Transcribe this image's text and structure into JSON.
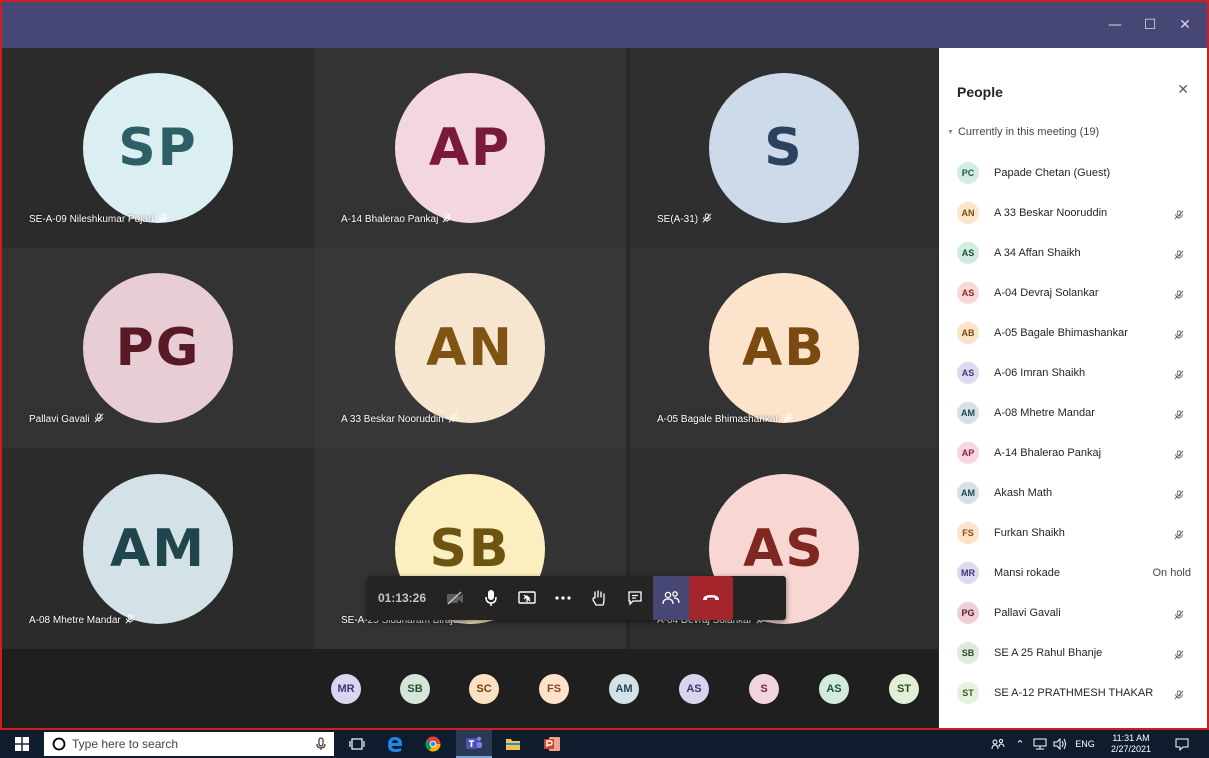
{
  "window": {
    "title_bar_color": "#464775",
    "controls": [
      "minimize-icon",
      "maximize-icon",
      "close-icon"
    ]
  },
  "grid": [
    {
      "initials": "SP",
      "name": "SE-A-09 Nileshkumar Pujari",
      "bg": "#dbeef1",
      "fg": "#2e5e66",
      "muted": true
    },
    {
      "initials": "AP",
      "name": "A-14 Bhalerao Pankaj",
      "bg": "#f4d6df",
      "fg": "#7a1a3a",
      "muted": true
    },
    {
      "initials": "S",
      "name": "SE(A-31)",
      "bg": "#ccdaea",
      "fg": "#2c4360",
      "muted": true
    },
    {
      "initials": "PG",
      "name": "Pallavi Gavali",
      "bg": "#e9cdd4",
      "fg": "#581b26",
      "muted": true
    },
    {
      "initials": "AN",
      "name": "A 33 Beskar Nooruddin",
      "bg": "#f6e6cf",
      "fg": "#7f5312",
      "muted": true
    },
    {
      "initials": "AB",
      "name": "A-05 Bagale Bhimashankar",
      "bg": "#fbe3cc",
      "fg": "#7b4a10",
      "muted": true
    },
    {
      "initials": "AM",
      "name": "A-08 Mhetre Mandar",
      "bg": "#d3e2e6",
      "fg": "#20454c",
      "muted": true
    },
    {
      "initials": "SB",
      "name": "SE-A-25 Siddharam Birajdar",
      "bg": "#fbefbf",
      "fg": "#6d5411",
      "muted": true
    },
    {
      "initials": "AS",
      "name": "A-04 Devraj Solankar",
      "bg": "#f8d7d3",
      "fg": "#7d2821",
      "muted": true
    }
  ],
  "call": {
    "timer": "01:13:26",
    "buttons": [
      "camera-off-icon",
      "microphone-icon",
      "share-screen-icon",
      "more-icon",
      "raise-hand-icon",
      "chat-icon",
      "participants-icon"
    ]
  },
  "overflow": [
    {
      "initials": "MR",
      "bg": "#d9d6f0",
      "fg": "#3d3675"
    },
    {
      "initials": "SB",
      "bg": "#d5e6d8",
      "fg": "#2b4d31"
    },
    {
      "initials": "SC",
      "bg": "#fbe0c4",
      "fg": "#6b4110"
    },
    {
      "initials": "FS",
      "bg": "#fde2c9",
      "fg": "#8a4a1a"
    },
    {
      "initials": "AM",
      "bg": "#d3e2e6",
      "fg": "#20454c"
    },
    {
      "initials": "AS",
      "bg": "#d7d5ee",
      "fg": "#3b3670"
    },
    {
      "initials": "S",
      "bg": "#f2d4dc",
      "fg": "#84213e"
    },
    {
      "initials": "AS",
      "bg": "#d3ebdd",
      "fg": "#1f5233"
    },
    {
      "initials": "ST",
      "bg": "#e1efd7",
      "fg": "#2d4f1b"
    }
  ],
  "people": {
    "title": "People",
    "section": "Currently in this meeting (19)",
    "list": [
      {
        "initials": "PC",
        "name": "Papade Chetan (Guest)",
        "status": "",
        "muted": false,
        "bg": "#d3ede3",
        "fg": "#1e5a40"
      },
      {
        "initials": "AN",
        "name": "A 33 Beskar Nooruddin",
        "status": "",
        "muted": true,
        "bg": "#fbe6c8",
        "fg": "#7a4a0e"
      },
      {
        "initials": "AS",
        "name": "A 34 Affan Shaikh",
        "status": "",
        "muted": true,
        "bg": "#d2ebe0",
        "fg": "#1f5138"
      },
      {
        "initials": "AS",
        "name": "A-04 Devraj Solankar",
        "status": "",
        "muted": true,
        "bg": "#f9d8d6",
        "fg": "#8a2720"
      },
      {
        "initials": "AB",
        "name": "A-05 Bagale Bhimashankar",
        "status": "",
        "muted": true,
        "bg": "#fbe3c8",
        "fg": "#7b4a10"
      },
      {
        "initials": "AS",
        "name": "A-06 Imran Shaikh",
        "status": "",
        "muted": true,
        "bg": "#dcdaf0",
        "fg": "#3c3676"
      },
      {
        "initials": "AM",
        "name": "A-08 Mhetre Mandar",
        "status": "",
        "muted": true,
        "bg": "#d3e2e6",
        "fg": "#20454c"
      },
      {
        "initials": "AP",
        "name": "A-14 Bhalerao Pankaj",
        "status": "",
        "muted": true,
        "bg": "#f8d6df",
        "fg": "#8c1e44"
      },
      {
        "initials": "AM",
        "name": "Akash Math",
        "status": "",
        "muted": true,
        "bg": "#d3e2e6",
        "fg": "#20454c"
      },
      {
        "initials": "FS",
        "name": "Furkan Shaikh",
        "status": "",
        "muted": true,
        "bg": "#fde2c9",
        "fg": "#8a4a1a"
      },
      {
        "initials": "MR",
        "name": "Mansi rokade",
        "status": "On hold",
        "muted": false,
        "bg": "#dcdaf0",
        "fg": "#3c3676"
      },
      {
        "initials": "PG",
        "name": "Pallavi Gavali",
        "status": "",
        "muted": true,
        "bg": "#ecd0d6",
        "fg": "#5e1c29"
      },
      {
        "initials": "SB",
        "name": "SE A 25 Rahul Bhanje",
        "status": "",
        "muted": true,
        "bg": "#dfe9dc",
        "fg": "#2f4f2a"
      },
      {
        "initials": "ST",
        "name": "SE A-12 PRATHMESH THAKAR",
        "status": "",
        "muted": true,
        "bg": "#e6f1dc",
        "fg": "#3a5a20"
      }
    ]
  },
  "taskbar": {
    "search_placeholder": "Type here to search",
    "lang": "ENG",
    "time": "11:31 AM",
    "date": "2/27/2021",
    "apps": [
      "cortana-mic-icon",
      "task-view-icon",
      "edge-icon",
      "chrome-icon",
      "teams-icon",
      "file-explorer-icon",
      "powerpoint-icon"
    ]
  }
}
